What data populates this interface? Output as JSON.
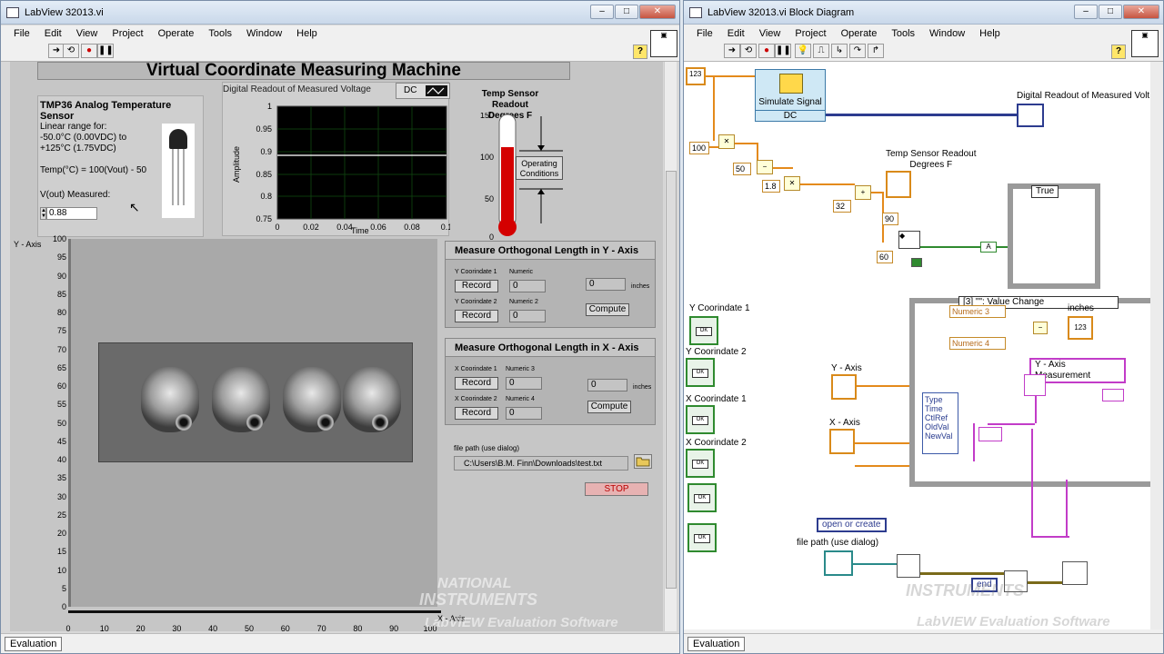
{
  "front_panel": {
    "title": "LabView 32013.vi",
    "menu": [
      "File",
      "Edit",
      "View",
      "Project",
      "Operate",
      "Tools",
      "Window",
      "Help"
    ],
    "main_title": "Virtual Coordinate Measuring Machine",
    "sensor": {
      "title": "TMP36 Analog Temperature Sensor",
      "line1": "Linear range for:",
      "line2": "-50.0°C (0.00VDC) to",
      "line3": "+125°C (1.75VDC)",
      "formula": "Temp(°C) = 100(Vout) - 50",
      "vout_label": "V(out) Measured:",
      "vout_value": "0.88"
    },
    "chart": {
      "title": "Digital Readout of Measured Voltage",
      "mode": "DC",
      "ylabel": "Amplitude",
      "xlabel": "Time",
      "yticks": [
        "1",
        "0.95",
        "0.9",
        "0.85",
        "0.8",
        "0.75"
      ],
      "xticks": [
        "0",
        "0.02",
        "0.04",
        "0.06",
        "0.08",
        "0.1"
      ]
    },
    "temp": {
      "title1": "Temp Sensor Readout",
      "title2": "Degrees F",
      "ticks": [
        "150",
        "100",
        "50",
        "0"
      ],
      "opcond1": "Operating",
      "opcond2": "Conditions"
    },
    "image_axes": {
      "y_label": "Y - Axis",
      "x_label": "X - Axis",
      "yticks": [
        "100",
        "95",
        "90",
        "85",
        "80",
        "75",
        "70",
        "65",
        "60",
        "55",
        "50",
        "45",
        "40",
        "35",
        "30",
        "25",
        "20",
        "15",
        "10",
        "5",
        "0"
      ],
      "xticks": [
        "0",
        "10",
        "20",
        "30",
        "40",
        "50",
        "60",
        "70",
        "80",
        "90",
        "100"
      ]
    },
    "measure_y": {
      "title": "Measure Orthogonal Length in Y - Axis",
      "c1": "Y Coorindate 1",
      "c2": "Y Coorindate 2",
      "n1": "Numeric",
      "n2": "Numeric 2",
      "record": "Record",
      "v1": "0",
      "v2": "0",
      "result": "0",
      "units": "inches",
      "compute": "Compute"
    },
    "measure_x": {
      "title": "Measure Orthogonal Length in X - Axis",
      "c1": "X Coorindate 1",
      "c2": "X Coorindate 2",
      "n1": "Numeric 3",
      "n2": "Numeric 4",
      "record": "Record",
      "v1": "0",
      "v2": "0",
      "result": "0",
      "units": "inches",
      "compute": "Compute"
    },
    "file_path_label": "file path (use dialog)",
    "file_path": "C:\\Users\\B.M. Finn\\Downloads\\test.txt",
    "stop": "STOP",
    "status": "Evaluation",
    "watermark1": "NATIONAL",
    "watermark2": "INSTRUMENTS",
    "watermark3": "LabVIEW Evaluation Software"
  },
  "block_diagram": {
    "title": "LabView 32013.vi Block Diagram",
    "menu": [
      "File",
      "Edit",
      "View",
      "Project",
      "Operate",
      "Tools",
      "Window",
      "Help"
    ],
    "simulate": "Simulate Signal",
    "dc": "DC",
    "readout": "Digital Readout of Measured Volt",
    "temp1": "Temp Sensor Readout",
    "temp2": "Degrees F",
    "c100": "100",
    "c50": "50",
    "c18": "1.8",
    "c32": "32",
    "c90": "90",
    "c60": "60",
    "case_true": "True",
    "event": "[3] \"\": Value Change",
    "numeric3": "Numeric 3",
    "numeric4": "Numeric 4",
    "inches": "inches",
    "ycoord1": "Y Coorindate 1",
    "ycoord2": "Y Coorindate 2",
    "xcoord1": "X Coorindate 1",
    "xcoord2": "X Coorindate 2",
    "yaxis": "Y - Axis",
    "xaxis": "X - Axis",
    "ymeas": "Y - Axis Measurement",
    "evfields": [
      "Type",
      "Time",
      "CtlRef",
      "OldVal",
      "NewVal"
    ],
    "open_create": "open or create",
    "file_path_label": "file path (use dialog)",
    "end": "end",
    "status": "Evaluation"
  }
}
